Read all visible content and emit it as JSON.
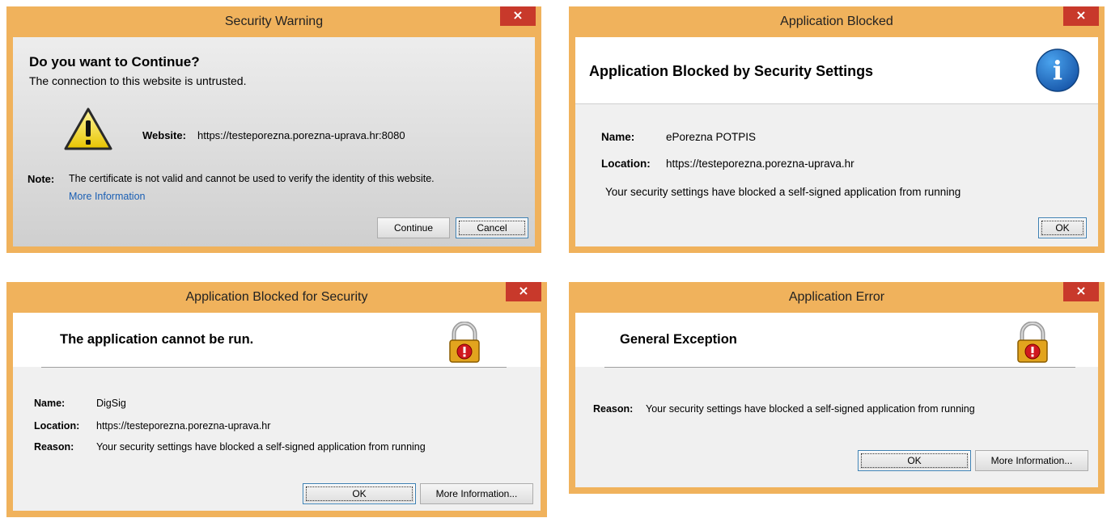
{
  "security_warning": {
    "title": "Security Warning",
    "close": "×",
    "heading": "Do you want to Continue?",
    "subheading": "The connection to this website is untrusted.",
    "website_label": "Website:",
    "website_value": "https://testeporezna.porezna-uprava.hr:8080",
    "note_label": "Note:",
    "note_text": "The certificate is not valid and cannot be used to verify the identity of this website.",
    "more_info_link": "More Information",
    "continue_button": "Continue",
    "cancel_button": "Cancel",
    "icon": "warning-icon"
  },
  "app_blocked": {
    "title": "Application Blocked",
    "close": "×",
    "heading": "Application Blocked by Security Settings",
    "name_label": "Name:",
    "name_value": "ePorezna POTPIS",
    "location_label": "Location:",
    "location_value": "https://testeporezna.porezna-uprava.hr",
    "message": "Your security settings have blocked a self-signed application from running",
    "ok_button": "OK",
    "icon": "info-icon",
    "icon_glyph": "i"
  },
  "app_blocked_security": {
    "title": "Application Blocked for Security",
    "close": "×",
    "heading": "The application cannot be run.",
    "name_label": "Name:",
    "name_value": "DigSig",
    "location_label": "Location:",
    "location_value": "https://testeporezna.porezna-uprava.hr",
    "reason_label": "Reason:",
    "reason_value": "Your security settings have blocked a self-signed application from running",
    "ok_button": "OK",
    "more_info_button": "More Information...",
    "icon": "padlock-error-icon"
  },
  "app_error": {
    "title": "Application Error",
    "close": "×",
    "heading": "General Exception",
    "reason_label": "Reason:",
    "reason_value": "Your security settings have blocked a self-signed application from running",
    "ok_button": "OK",
    "more_info_button": "More Information...",
    "icon": "padlock-error-icon"
  },
  "colors": {
    "frame": "#f0b25c",
    "close": "#c8392b",
    "link": "#1a5fb4",
    "info_icon": "#1f6fc4"
  }
}
